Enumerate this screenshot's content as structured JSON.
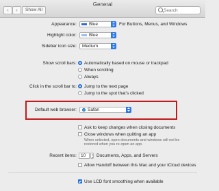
{
  "window": {
    "title": "General"
  },
  "toolbar": {
    "back_label": "‹",
    "forward_label": "›",
    "show_all_label": "Show All",
    "search_placeholder": "Search"
  },
  "appearance": {
    "label": "Appearance:",
    "value": "Blue",
    "note": "For Buttons, Menus, and Windows",
    "accent": "#2f6ad9"
  },
  "highlight": {
    "label": "Highlight color:",
    "value": "Blue"
  },
  "sidebar_icon": {
    "label": "Sidebar icon size:",
    "value": "Medium"
  },
  "scroll_bars": {
    "label": "Show scroll bars:",
    "options": [
      "Automatically based on mouse or trackpad",
      "When scrolling",
      "Always"
    ],
    "selected": 0
  },
  "click_scroll": {
    "label": "Click in the scroll bar to:",
    "options": [
      "Jump to the next page",
      "Jump to the spot that's clicked"
    ],
    "selected": 0
  },
  "browser": {
    "label": "Default web browser:",
    "value": "Safari"
  },
  "documents": {
    "ask_label": "Ask to keep changes when closing documents",
    "close_label": "Close windows when quitting an app",
    "close_note_1": "When selected, open documents and windows will not be",
    "close_note_2": "restored when you re-open an app."
  },
  "recent": {
    "label": "Recent items:",
    "value": "10",
    "suffix": "Documents, Apps, and Servers"
  },
  "handoff": {
    "label": "Allow Handoff between this Mac and your iCloud devices"
  },
  "lcd": {
    "label": "Use LCD font smoothing when available"
  },
  "colors": {
    "highlight_box": "#c21a1a",
    "control_blue": "#2e78e4"
  }
}
